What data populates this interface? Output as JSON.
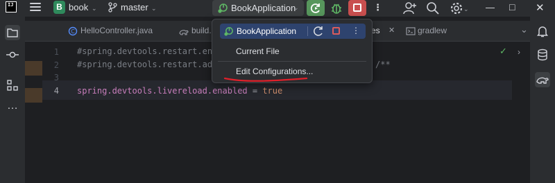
{
  "toolbar": {
    "logo": "IJ",
    "project_initial": "B",
    "project_name": "book",
    "branch": "master",
    "run_config": "BookApplication"
  },
  "tabs": [
    {
      "label": "HelloController.java"
    },
    {
      "label": "build."
    },
    {
      "label": "es"
    },
    {
      "label": "gradlew"
    }
  ],
  "editor": {
    "line_numbers": [
      "1",
      "2",
      "3",
      "4"
    ],
    "lines": [
      "#spring.devtools.restart.ena",
      "#spring.devtools.restart.add",
      "",
      "spring.devtools.livereload.enabled = true"
    ],
    "line2_tail": "/**",
    "line4_key": "spring.devtools.livereload.enabled",
    "line4_eq": " = ",
    "line4_val": "true"
  },
  "popup": {
    "selected": "BookApplication",
    "items": [
      "Current File",
      "Edit Configurations..."
    ]
  },
  "colors": {
    "accent_run": "#57965c",
    "stop": "#c94f4f",
    "selection": "#2e436e",
    "annotation": "#e0202a"
  }
}
